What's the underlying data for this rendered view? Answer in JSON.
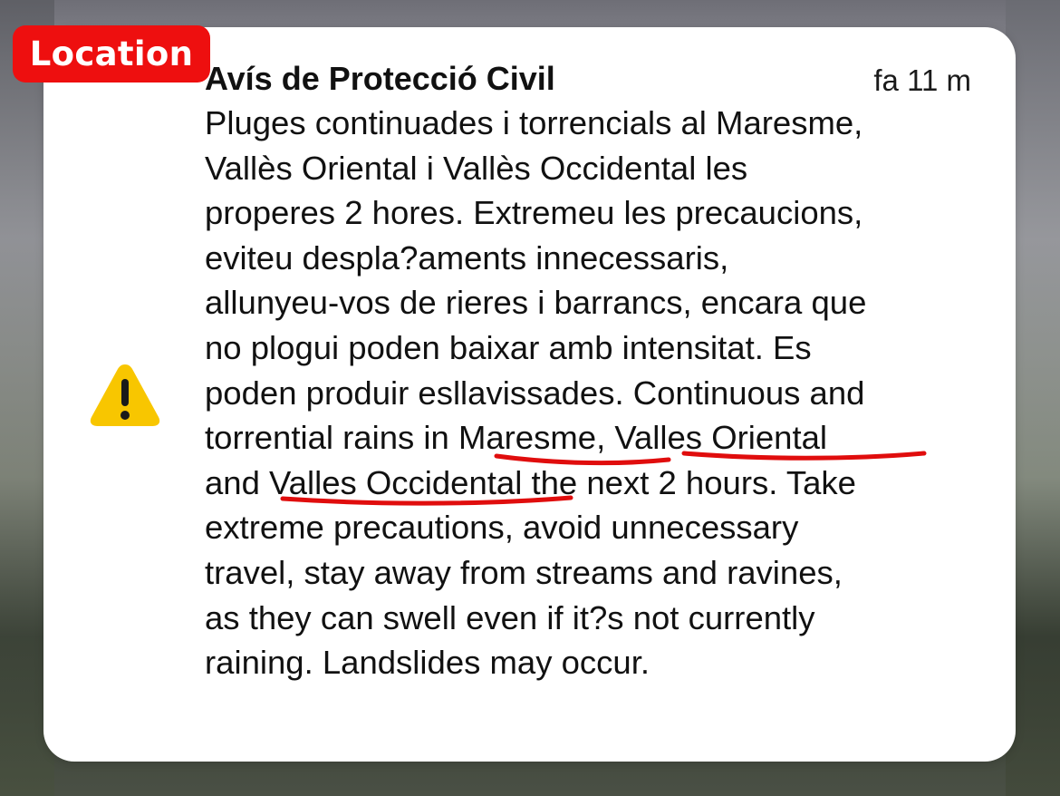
{
  "tag": {
    "label": "Location",
    "color": "#ee0f0f"
  },
  "notification": {
    "title": "Avís de Protecció Civil",
    "time": "fa 11 m",
    "icon": "warning-icon",
    "body_lines": [
      "Pluges continuades i torrencials al Maresme,",
      "Vallès Oriental i Vallès Occidental les",
      "properes 2 hores. Extremeu les precaucions,",
      "eviteu despla?aments innecessaris,",
      "allunyeu-vos de rieres i barrancs, encara que",
      "no plogui poden baixar amb intensitat. Es",
      "poden produir esllavissades. Continuous and",
      "torrential rains in Maresme, Valles Oriental",
      "and Valles Occidental the next 2 hours. Take",
      "extreme precautions, avoid unnecessary",
      "travel, stay away from streams and ravines,",
      "as they can swell even if it?s not currently",
      "raining. Landslides may occur."
    ]
  },
  "annotations": {
    "underline_color": "#e00d0d",
    "underlined_terms": [
      "Maresme",
      "Valles Oriental",
      "Valles Occidental"
    ]
  }
}
